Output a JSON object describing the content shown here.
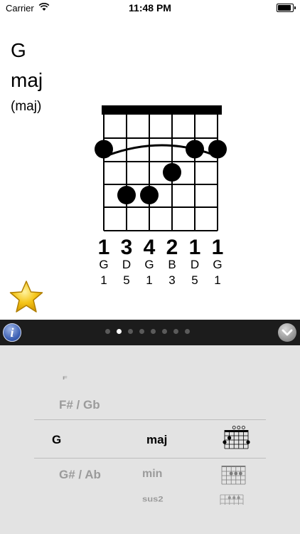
{
  "status_bar": {
    "carrier": "Carrier",
    "time": "11:48 PM",
    "battery_level": 0.9
  },
  "chord": {
    "root": "G",
    "quality": "maj",
    "alias": "(maj)",
    "fingers": [
      "1",
      "3",
      "4",
      "2",
      "1",
      "1"
    ],
    "notes": [
      "G",
      "D",
      "G",
      "B",
      "D",
      "G"
    ],
    "intervals": [
      "1",
      "5",
      "1",
      "3",
      "5",
      "1"
    ],
    "dot_frets": [
      3,
      5,
      5,
      4,
      3,
      3
    ],
    "barre": "arc over strings 1-6"
  },
  "toolbar": {
    "info_icon": "info-icon",
    "collapse_icon": "chevron-down-icon",
    "page_count": 8,
    "active_page": 2
  },
  "picker": {
    "roots_above": [
      "F",
      "F# / Gb"
    ],
    "selected_root": "G",
    "selected_quality": "maj",
    "roots_below": [
      "G# / Ab"
    ],
    "qualities_below": [
      "min",
      "sus2"
    ]
  },
  "colors": {
    "toolbar_bg": "#1c1c1c",
    "picker_bg": "#e3e3e3",
    "star": "#f5c518"
  }
}
